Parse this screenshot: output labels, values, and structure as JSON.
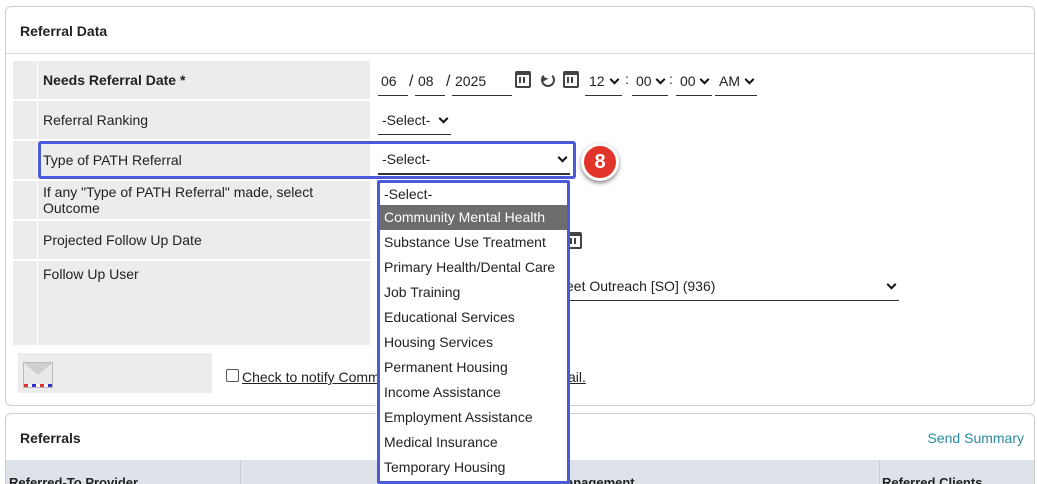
{
  "referral_data": {
    "title": "Referral Data",
    "needs_referral_date": {
      "label": "Needs Referral Date *",
      "month": "06",
      "day": "08",
      "year": "2025",
      "slash": "/",
      "hour": "12",
      "minute": "00",
      "second": "00",
      "ampm": "AM",
      "colon": ":"
    },
    "referral_ranking": {
      "label": "Referral Ranking",
      "value": "-Select-"
    },
    "type_of_path_referral": {
      "label": "Type of PATH Referral",
      "value": "-Select-"
    },
    "outcome": {
      "label": "If any \"Type of PATH Referral\" made, select Outcome"
    },
    "projected_follow_up": {
      "label": "Projected Follow Up Date"
    },
    "follow_up_user": {
      "label": "Follow Up User",
      "value_visible": "eet Outreach [SO] (936)"
    },
    "notify": {
      "text_left": "Check to notify Comm",
      "text_right": "ail."
    },
    "step_badge": "8",
    "dropdown_options": [
      "-Select-",
      "Community Mental Health",
      "Substance Use Treatment",
      "Primary Health/Dental Care",
      "Job Training",
      "Educational Services",
      "Housing Services",
      "Permanent Housing",
      "Income Assistance",
      "Employment Assistance",
      "Medical Insurance",
      "Temporary Housing"
    ],
    "dropdown_highlighted": "Community Mental Health"
  },
  "referrals": {
    "title": "Referrals",
    "send_summary": "Send Summary",
    "columns": [
      "Referred-To Provider",
      "anagement",
      "Referred Clients"
    ]
  },
  "colors": {
    "highlight": "#4a5ad9",
    "badge": "#e2342a",
    "row_bg": "#ececec",
    "link": "#2a8aa3",
    "dropdown_active": "#6d6d6d"
  }
}
